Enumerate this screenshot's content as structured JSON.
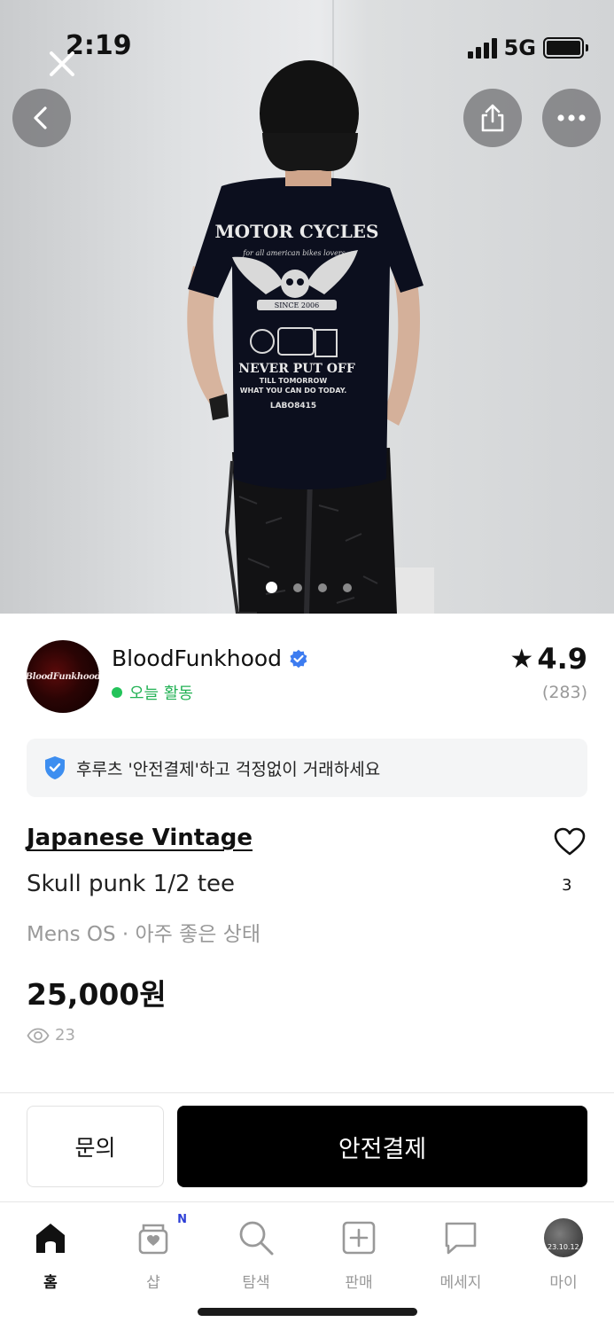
{
  "status_bar": {
    "time": "2:19",
    "network": "5G"
  },
  "photo": {
    "shirt_text_line1": "MOTOR CYCLES",
    "shirt_text_line2": "for all american bikes lovers",
    "shirt_text_line3": "SINCE 2006",
    "shirt_text_line4": "NEVER PUT OFF",
    "shirt_text_line5": "TILL TOMORROW",
    "shirt_text_line6": "WHAT YOU CAN DO TODAY.",
    "shirt_text_line7": "LABO8415",
    "page_count": 4,
    "active_page": 1
  },
  "seller": {
    "avatar_text": "BloodFunkhood",
    "name": "BloodFunkhood",
    "activity": "오늘 활동",
    "rating": "4.9",
    "rating_count": "(283)"
  },
  "notice": {
    "text": "후루츠 '안전결제'하고 걱정없이 거래하세요"
  },
  "item": {
    "brand": "Japanese Vintage",
    "title": "Skull punk 1/2 tee",
    "meta": "Mens OS · 아주 좋은 상태",
    "price": "25,000원",
    "views": "23",
    "likes": "3"
  },
  "actions": {
    "inquiry": "문의",
    "safe_pay": "안전결제"
  },
  "tabbar": {
    "home": "홈",
    "shop": "샵",
    "shop_badge": "N",
    "search": "탐색",
    "sell": "판매",
    "message": "메세지",
    "my": "마이",
    "my_avatar_text": "23.10.12"
  },
  "colors": {
    "accent_green": "#23c35a",
    "verified_blue": "#3d7cf0",
    "primary_button": "#000000"
  }
}
